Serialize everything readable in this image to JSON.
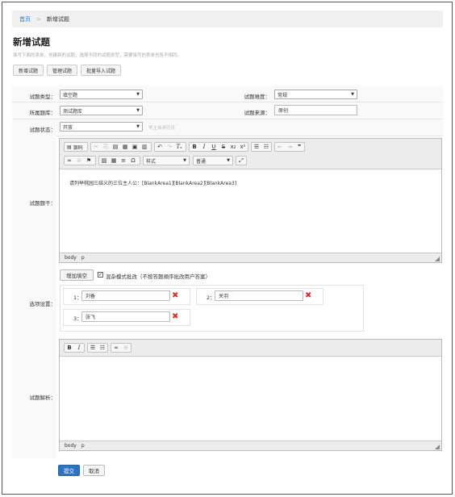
{
  "breadcrumb": {
    "home": "首页",
    "separator": ">",
    "current": "新增试题"
  },
  "page": {
    "title": "新增试题",
    "description": "填写下面的表单，创建新的试题，选择不同的试题类型，需要填写的表单也各不相同。"
  },
  "tabs": [
    {
      "label": "新增试题"
    },
    {
      "label": "管理试题"
    },
    {
      "label": "批量导入试题"
    }
  ],
  "form": {
    "type": {
      "label": "试题类型：",
      "value": "填空题"
    },
    "difficulty": {
      "label": "试题难度：",
      "value": "常规"
    },
    "bank": {
      "label": "所属题库：",
      "value": "测试题库"
    },
    "source": {
      "label": "试题来源：",
      "value": "原创"
    },
    "status": {
      "label": "试题状态：",
      "value": "开放",
      "hint": "学主自测可见"
    },
    "stem": {
      "label": "试题题干：",
      "content": "请列举桃园三结义的三位主人公：[BlankArea1][BlankArea2][BlankArea3]",
      "status_path": [
        "body",
        "p"
      ],
      "source_label": "源码",
      "style_select": "样式",
      "format_select": "普通"
    },
    "options": {
      "label": "选项设置：",
      "add_button": "增加填空",
      "mixed_mode_label": "混杂模式批改（不按答题顺序批改用户答案）",
      "mixed_mode_checked": true,
      "items": [
        {
          "num": "1：",
          "value": "刘备"
        },
        {
          "num": "2：",
          "value": "关羽"
        },
        {
          "num": "3：",
          "value": "张飞"
        }
      ]
    },
    "analysis": {
      "label": "试题解析：",
      "status_path": [
        "body",
        "p"
      ]
    }
  },
  "actions": {
    "submit": "提交",
    "cancel": "取消"
  },
  "colors": {
    "primary": "#2e73c2",
    "link": "#2a79c7",
    "delete": "#d0342c"
  }
}
